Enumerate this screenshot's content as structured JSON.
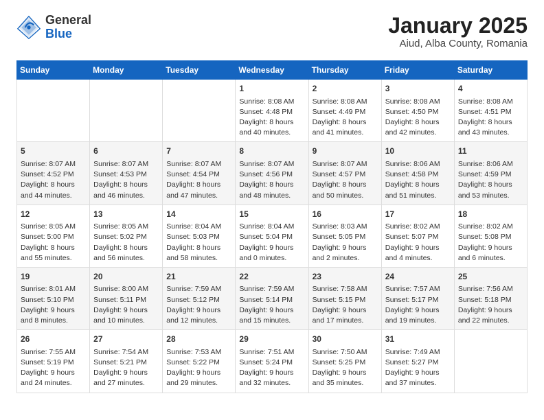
{
  "header": {
    "logo_general": "General",
    "logo_blue": "Blue",
    "title": "January 2025",
    "subtitle": "Aiud, Alba County, Romania"
  },
  "days_of_week": [
    "Sunday",
    "Monday",
    "Tuesday",
    "Wednesday",
    "Thursday",
    "Friday",
    "Saturday"
  ],
  "weeks": [
    [
      {
        "day": "",
        "content": ""
      },
      {
        "day": "",
        "content": ""
      },
      {
        "day": "",
        "content": ""
      },
      {
        "day": "1",
        "content": "Sunrise: 8:08 AM\nSunset: 4:48 PM\nDaylight: 8 hours\nand 40 minutes."
      },
      {
        "day": "2",
        "content": "Sunrise: 8:08 AM\nSunset: 4:49 PM\nDaylight: 8 hours\nand 41 minutes."
      },
      {
        "day": "3",
        "content": "Sunrise: 8:08 AM\nSunset: 4:50 PM\nDaylight: 8 hours\nand 42 minutes."
      },
      {
        "day": "4",
        "content": "Sunrise: 8:08 AM\nSunset: 4:51 PM\nDaylight: 8 hours\nand 43 minutes."
      }
    ],
    [
      {
        "day": "5",
        "content": "Sunrise: 8:07 AM\nSunset: 4:52 PM\nDaylight: 8 hours\nand 44 minutes."
      },
      {
        "day": "6",
        "content": "Sunrise: 8:07 AM\nSunset: 4:53 PM\nDaylight: 8 hours\nand 46 minutes."
      },
      {
        "day": "7",
        "content": "Sunrise: 8:07 AM\nSunset: 4:54 PM\nDaylight: 8 hours\nand 47 minutes."
      },
      {
        "day": "8",
        "content": "Sunrise: 8:07 AM\nSunset: 4:56 PM\nDaylight: 8 hours\nand 48 minutes."
      },
      {
        "day": "9",
        "content": "Sunrise: 8:07 AM\nSunset: 4:57 PM\nDaylight: 8 hours\nand 50 minutes."
      },
      {
        "day": "10",
        "content": "Sunrise: 8:06 AM\nSunset: 4:58 PM\nDaylight: 8 hours\nand 51 minutes."
      },
      {
        "day": "11",
        "content": "Sunrise: 8:06 AM\nSunset: 4:59 PM\nDaylight: 8 hours\nand 53 minutes."
      }
    ],
    [
      {
        "day": "12",
        "content": "Sunrise: 8:05 AM\nSunset: 5:00 PM\nDaylight: 8 hours\nand 55 minutes."
      },
      {
        "day": "13",
        "content": "Sunrise: 8:05 AM\nSunset: 5:02 PM\nDaylight: 8 hours\nand 56 minutes."
      },
      {
        "day": "14",
        "content": "Sunrise: 8:04 AM\nSunset: 5:03 PM\nDaylight: 8 hours\nand 58 minutes."
      },
      {
        "day": "15",
        "content": "Sunrise: 8:04 AM\nSunset: 5:04 PM\nDaylight: 9 hours\nand 0 minutes."
      },
      {
        "day": "16",
        "content": "Sunrise: 8:03 AM\nSunset: 5:05 PM\nDaylight: 9 hours\nand 2 minutes."
      },
      {
        "day": "17",
        "content": "Sunrise: 8:02 AM\nSunset: 5:07 PM\nDaylight: 9 hours\nand 4 minutes."
      },
      {
        "day": "18",
        "content": "Sunrise: 8:02 AM\nSunset: 5:08 PM\nDaylight: 9 hours\nand 6 minutes."
      }
    ],
    [
      {
        "day": "19",
        "content": "Sunrise: 8:01 AM\nSunset: 5:10 PM\nDaylight: 9 hours\nand 8 minutes."
      },
      {
        "day": "20",
        "content": "Sunrise: 8:00 AM\nSunset: 5:11 PM\nDaylight: 9 hours\nand 10 minutes."
      },
      {
        "day": "21",
        "content": "Sunrise: 7:59 AM\nSunset: 5:12 PM\nDaylight: 9 hours\nand 12 minutes."
      },
      {
        "day": "22",
        "content": "Sunrise: 7:59 AM\nSunset: 5:14 PM\nDaylight: 9 hours\nand 15 minutes."
      },
      {
        "day": "23",
        "content": "Sunrise: 7:58 AM\nSunset: 5:15 PM\nDaylight: 9 hours\nand 17 minutes."
      },
      {
        "day": "24",
        "content": "Sunrise: 7:57 AM\nSunset: 5:17 PM\nDaylight: 9 hours\nand 19 minutes."
      },
      {
        "day": "25",
        "content": "Sunrise: 7:56 AM\nSunset: 5:18 PM\nDaylight: 9 hours\nand 22 minutes."
      }
    ],
    [
      {
        "day": "26",
        "content": "Sunrise: 7:55 AM\nSunset: 5:19 PM\nDaylight: 9 hours\nand 24 minutes."
      },
      {
        "day": "27",
        "content": "Sunrise: 7:54 AM\nSunset: 5:21 PM\nDaylight: 9 hours\nand 27 minutes."
      },
      {
        "day": "28",
        "content": "Sunrise: 7:53 AM\nSunset: 5:22 PM\nDaylight: 9 hours\nand 29 minutes."
      },
      {
        "day": "29",
        "content": "Sunrise: 7:51 AM\nSunset: 5:24 PM\nDaylight: 9 hours\nand 32 minutes."
      },
      {
        "day": "30",
        "content": "Sunrise: 7:50 AM\nSunset: 5:25 PM\nDaylight: 9 hours\nand 35 minutes."
      },
      {
        "day": "31",
        "content": "Sunrise: 7:49 AM\nSunset: 5:27 PM\nDaylight: 9 hours\nand 37 minutes."
      },
      {
        "day": "",
        "content": ""
      }
    ]
  ]
}
